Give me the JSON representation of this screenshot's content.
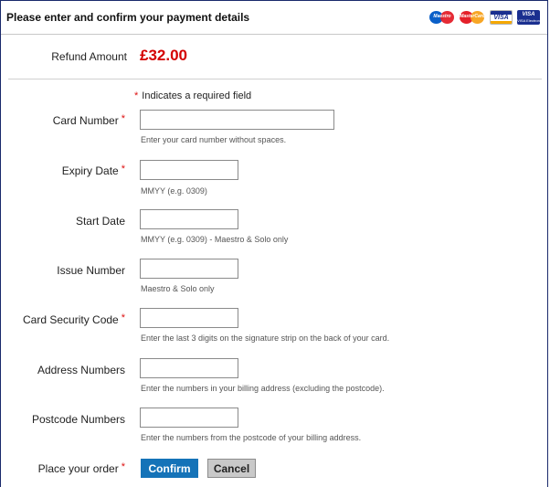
{
  "header": {
    "title": "Please enter and confirm your payment details",
    "card_logos": [
      {
        "name": "Maestro",
        "icon": "maestro-logo"
      },
      {
        "name": "MasterCard",
        "icon": "mastercard-logo"
      },
      {
        "name": "VISA",
        "icon": "visa-logo"
      },
      {
        "name": "VISA Electron",
        "icon": "visa-electron-logo"
      }
    ]
  },
  "refund": {
    "label": "Refund Amount",
    "amount": "£32.00"
  },
  "required_note": {
    "star": "*",
    "text": "Indicates a required field"
  },
  "fields": {
    "card_number": {
      "label": "Card Number",
      "value": "",
      "hint": "Enter your card number without spaces."
    },
    "expiry_date": {
      "label": "Expiry Date",
      "value": "",
      "hint": "MMYY (e.g. 0309)"
    },
    "start_date": {
      "label": "Start Date",
      "value": "",
      "hint": "MMYY (e.g. 0309) - Maestro & Solo only"
    },
    "issue_number": {
      "label": "Issue Number",
      "value": "",
      "hint": "Maestro & Solo only"
    },
    "security_code": {
      "label": "Card Security Code",
      "value": "",
      "hint": "Enter the last 3 digits on the signature strip on the back of your card."
    },
    "address_numbers": {
      "label": "Address Numbers",
      "value": "",
      "hint": "Enter the numbers in your billing address (excluding the postcode)."
    },
    "postcode_numbers": {
      "label": "Postcode Numbers",
      "value": "",
      "hint": "Enter the numbers from the postcode of your billing address."
    }
  },
  "order": {
    "label": "Place your order",
    "confirm_label": "Confirm",
    "cancel_label": "Cancel"
  },
  "colors": {
    "amount": "#d40000",
    "required": "#dd1111",
    "confirm_button": "#1573b8",
    "cancel_button": "#c9c9c9"
  }
}
